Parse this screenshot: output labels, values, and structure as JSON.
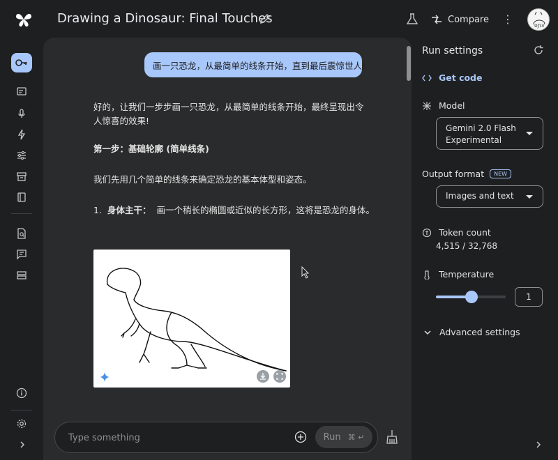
{
  "app": {
    "title": "Drawing a Dinosaur: Final Touches"
  },
  "header": {
    "compare_label": "Compare"
  },
  "chat": {
    "user_message": "画一只恐龙，从最简单的线条开始，直到最后震惊世人!",
    "response": {
      "intro": "好的，让我们一步步画一只恐龙，从最简单的线条开始，最终呈现出令人惊喜的效果!",
      "step1_heading": "第一步：基础轮廓 (简单线条)",
      "step1_paragraph": "我们先用几个简单的线条来确定恐龙的基本体型和姿态。",
      "list_item_number": "1.",
      "list_item_bold": "身体主干：",
      "list_item_text": "画一个稍长的椭圆或近似的长方形，这将是恐龙的身体。"
    }
  },
  "input": {
    "placeholder": "Type something",
    "run_label": "Run",
    "run_shortcut": "⌘ ↵"
  },
  "run_settings": {
    "title": "Run settings",
    "get_code": "Get code",
    "model_label": "Model",
    "model_value_line1": "Gemini 2.0 Flash",
    "model_value_line2": "Experimental",
    "output_format_label": "Output format",
    "new_badge": "NEW",
    "output_format_value": "Images and text",
    "token_count_label": "Token count",
    "token_count_value": "4,515 / 32,768",
    "temperature_label": "Temperature",
    "temperature_value": "1",
    "temperature_fraction": 0.5,
    "advanced_label": "Advanced settings"
  },
  "icons": {
    "logo": "gemini-sparkle-logo",
    "rail": [
      "key-icon",
      "chat-prompt-icon",
      "mic-icon",
      "bolt-icon",
      "tune-icon",
      "archive-icon",
      "book-icon",
      "doc-search-icon",
      "feedback-icon",
      "storage-icon",
      "info-icon",
      "settings-icon",
      "chevron-right-icon"
    ]
  },
  "colors": {
    "accent": "#a8c7fa",
    "background": "#1e1f20",
    "panel": "#2a2b2c"
  }
}
